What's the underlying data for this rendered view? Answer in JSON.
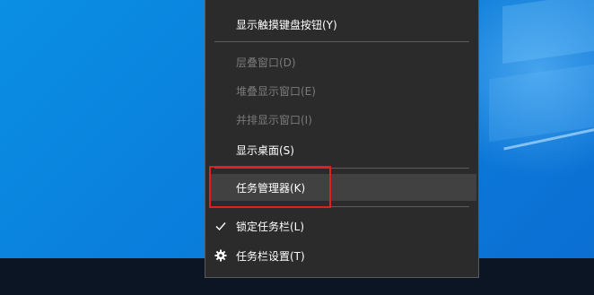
{
  "context_menu": {
    "items": [
      {
        "label": "显示触摸键盘按钮(Y)",
        "enabled": true
      },
      {
        "label": "层叠窗口(D)",
        "enabled": false
      },
      {
        "label": "堆叠显示窗口(E)",
        "enabled": false
      },
      {
        "label": "并排显示窗口(I)",
        "enabled": false
      },
      {
        "label": "显示桌面(S)",
        "enabled": true
      },
      {
        "label": "任务管理器(K)",
        "enabled": true,
        "highlighted": true
      },
      {
        "label": "锁定任务栏(L)",
        "enabled": true,
        "checked": true,
        "icon": "checkmark-icon"
      },
      {
        "label": "任务栏设置(T)",
        "enabled": true,
        "icon": "gear-icon"
      }
    ]
  },
  "colors": {
    "menu_background": "#2b2b2b",
    "highlight": "#414141",
    "annotation_box": "#e0201c",
    "desktop": "#0a7fdc",
    "taskbar": "#0c1524"
  }
}
